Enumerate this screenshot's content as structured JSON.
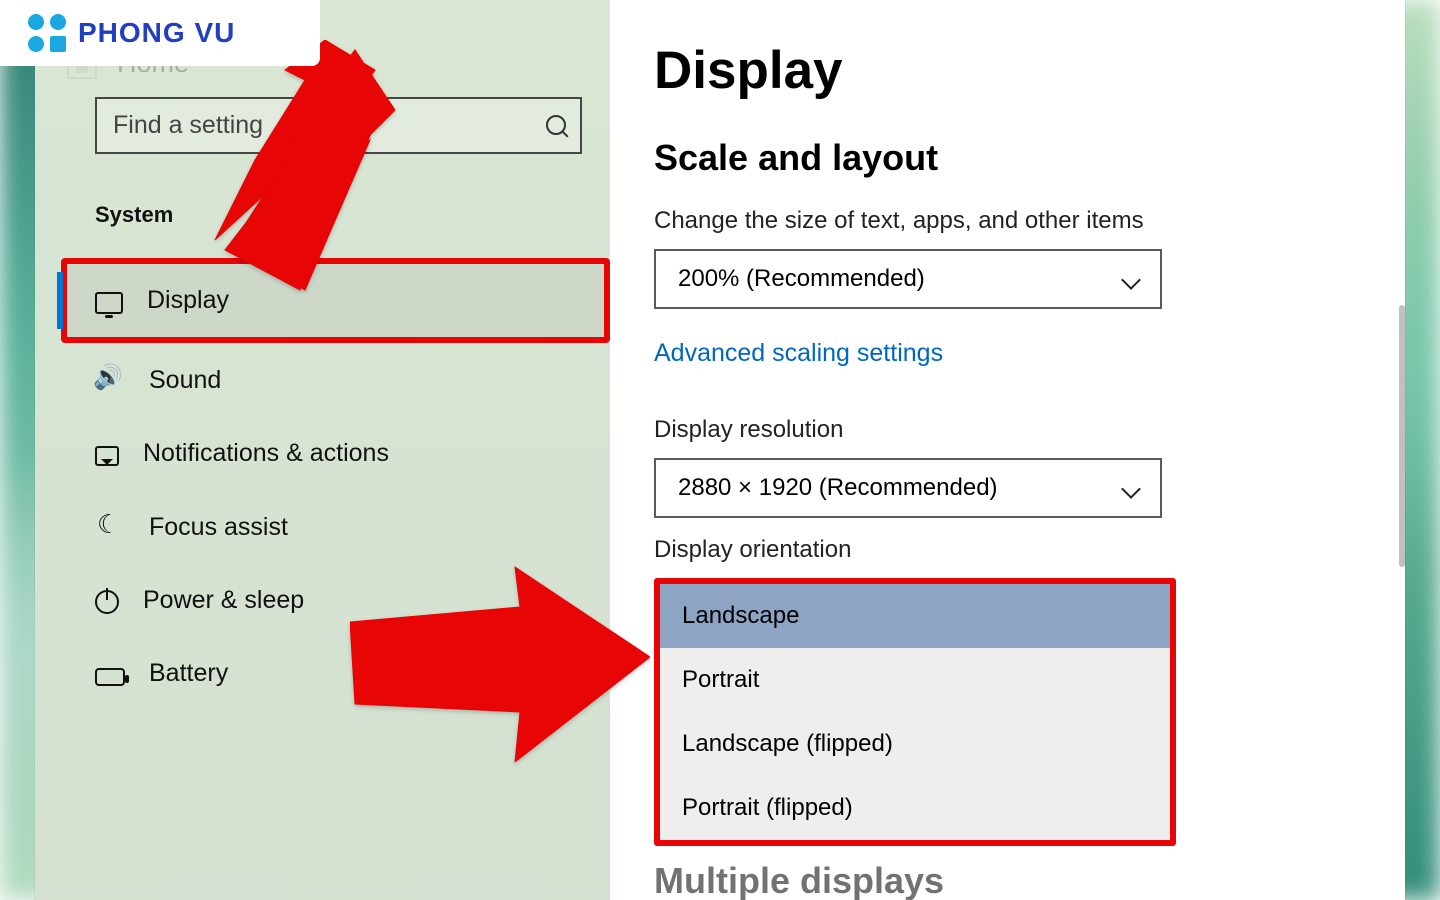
{
  "logo_text": "PHONG VU",
  "sidebar": {
    "home_label": "Home",
    "search_placeholder": "Find a setting",
    "category": "System",
    "items": [
      {
        "label": "Display"
      },
      {
        "label": "Sound"
      },
      {
        "label": "Notifications & actions"
      },
      {
        "label": "Focus assist"
      },
      {
        "label": "Power & sleep"
      },
      {
        "label": "Battery"
      }
    ]
  },
  "main": {
    "page_title": "Display",
    "section_scale": "Scale and layout",
    "scale_label": "Change the size of text, apps, and other items",
    "scale_value": "200% (Recommended)",
    "advanced_link": "Advanced scaling settings",
    "resolution_label": "Display resolution",
    "resolution_value": "2880 × 1920 (Recommended)",
    "orientation_label": "Display orientation",
    "orientation_options": {
      "o0": "Landscape",
      "o1": "Portrait",
      "o2": "Landscape (flipped)",
      "o3": "Portrait (flipped)"
    },
    "multiple_displays": "Multiple displays"
  }
}
